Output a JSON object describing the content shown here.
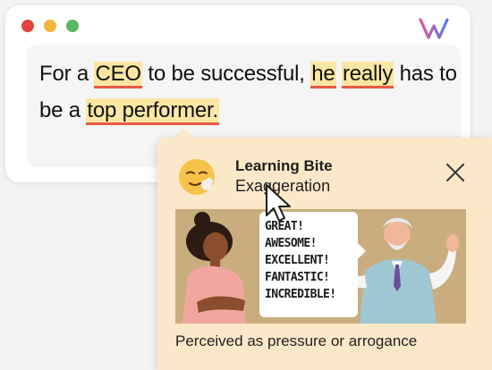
{
  "sentence": {
    "parts": [
      {
        "text": "For a ",
        "flagged": false
      },
      {
        "text": "CEO",
        "flagged": true
      },
      {
        "text": " to be successful, ",
        "flagged": false
      },
      {
        "text": "he",
        "flagged": true
      },
      {
        "text": " ",
        "flagged": false
      },
      {
        "text": "really",
        "flagged": true
      },
      {
        "text": " has to be a ",
        "flagged": false
      },
      {
        "text": "top performer.",
        "flagged": true
      }
    ]
  },
  "popup": {
    "title": "Learning Bite",
    "subtitle": "Exaggeration",
    "close_icon": "close-icon",
    "emoji_icon": "worried-face-emoji-icon",
    "bubble_lines": [
      "GREAT!",
      "AWESOME!",
      "EXCELLENT!",
      "FANTASTIC!",
      "INCREDIBLE!"
    ],
    "caption": "Perceived as pressure or arrogance"
  },
  "colors": {
    "highlight": "#fbe7a3",
    "underline": "#e85a45",
    "popup_bg": "#fbe8c8",
    "illustration_bg": "#c9ad7e",
    "dot_red": "#e0443a",
    "dot_yellow": "#f4b53d",
    "dot_green": "#58b763"
  },
  "icons": {
    "logo": "app-logo-icon",
    "cursor": "mouse-pointer-icon"
  }
}
